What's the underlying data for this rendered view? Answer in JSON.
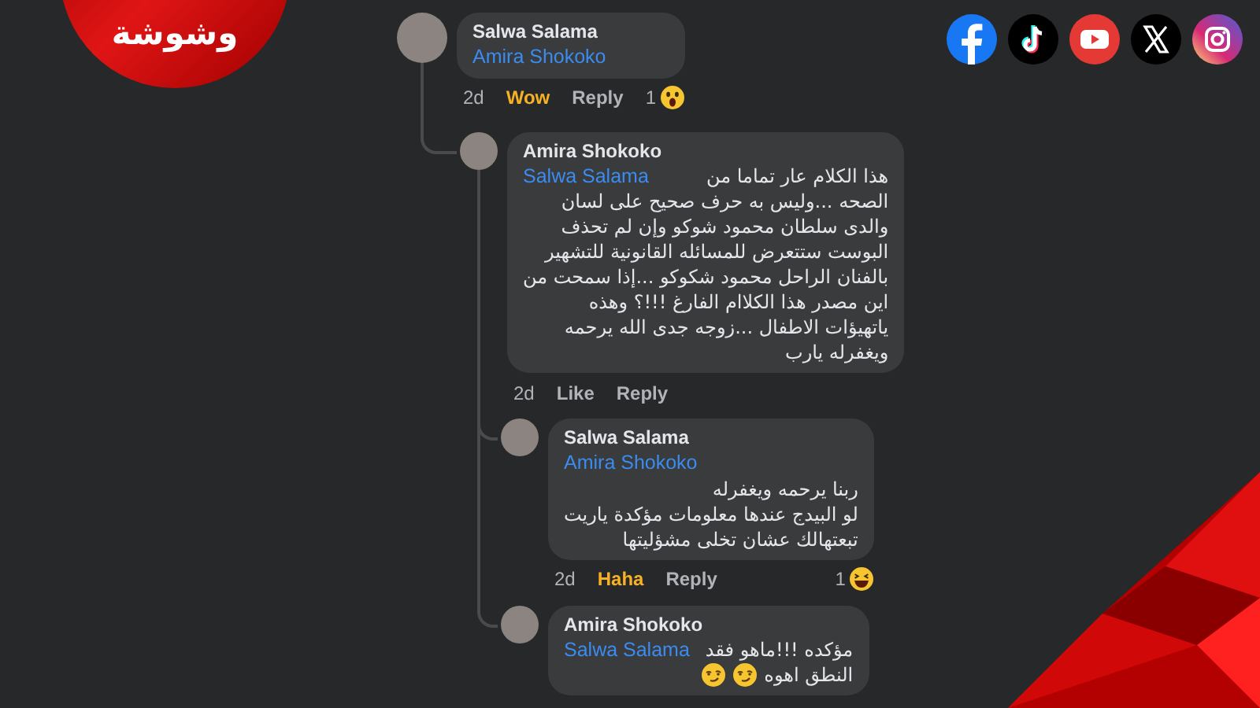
{
  "logo": {
    "text": "وشوشة"
  },
  "social_links": [
    {
      "kind": "facebook"
    },
    {
      "kind": "tiktok"
    },
    {
      "kind": "youtube"
    },
    {
      "kind": "x"
    },
    {
      "kind": "instagram"
    }
  ],
  "comments": [
    {
      "author": "Salwa Salama",
      "mention": "Amira Shokoko",
      "mention_inline": false,
      "time": "2d",
      "reaction": {
        "label": "Wow",
        "kind": "wow"
      },
      "reply": "Reply",
      "count": "1",
      "children": [
        {
          "author": "Amira Shokoko",
          "mention": "Salwa Salama",
          "mention_inline": true,
          "lines": [
            {
              "text": "هذا الكلام عار تماما من"
            },
            {
              "text": "الصحه ...وليس به حرف صحيح على لسان"
            },
            {
              "text": "والدى سلطان محمود شوكو وإن لم تحذف"
            },
            {
              "text": "البوست ستتعرض للمسائله القانونية للتشهير"
            },
            {
              "text": "بالفنان الراحل محمود شكوكو ...إذا سمحت من"
            },
            {
              "text": "اين مصدر هذا الكلاام الفارغ !!!؟ وهذه"
            },
            {
              "text": "ياتهيؤات الاطفال ...زوجه جدى الله يرحمه"
            },
            {
              "text": "ويغفرله يارب"
            }
          ],
          "time": "2d",
          "reaction": {
            "label": "Like",
            "kind": "none"
          },
          "reply": "Reply",
          "children": [
            {
              "author": "Salwa Salama",
              "mention": "Amira Shokoko",
              "mention_inline": false,
              "lines": [
                {
                  "text": "ربنا يرحمه ويغفرله"
                },
                {
                  "text": "لو البيدج عندها معلومات مؤكدة ياريت"
                },
                {
                  "text": "تبعتهالك عشان تخلى مشؤليتها"
                }
              ],
              "time": "2d",
              "reaction": {
                "label": "Haha",
                "kind": "haha"
              },
              "reply": "Reply",
              "count": "1"
            },
            {
              "author": "Amira Shokoko",
              "mention": "Salwa Salama",
              "mention_inline": true,
              "lines": [
                {
                  "text": "مؤكده !!!ماهو فقد"
                },
                {
                  "text": "النطق اهوه",
                  "kind": "with_emojis"
                }
              ]
            }
          ]
        }
      ]
    }
  ]
}
